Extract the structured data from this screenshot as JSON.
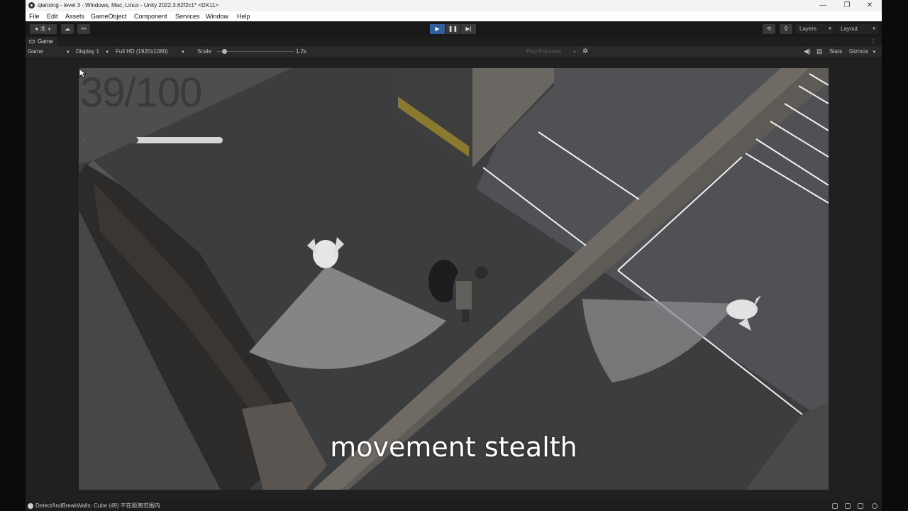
{
  "window": {
    "title": "qianxing - level 3 - Windows, Mac, Linux - Unity 2022.3.62f2c1* <DX11>",
    "minimize": "—",
    "restore": "❐",
    "close": "✕"
  },
  "menu": [
    "File",
    "Edit",
    "Assets",
    "GameObject",
    "Component",
    "Services",
    "Window",
    "Help"
  ],
  "toolbar": {
    "account_label": "北",
    "play": "▶",
    "pause": "❚❚",
    "step": "▶|",
    "layers": "Layers",
    "layout": "Layout",
    "history_icon": "history-icon",
    "search_icon": "search-icon"
  },
  "game_tab": {
    "label": "Game",
    "menu": "⋮"
  },
  "game_controls": {
    "view_mode": "Game",
    "display": "Display 1",
    "resolution": "Full HD (1920x1080)",
    "scale_label": "Scale",
    "scale_value": "1.2x",
    "play_focused": "Play Focused",
    "stats": "Stats",
    "gizmos": "Gizmos"
  },
  "hud": {
    "counter": "39/100",
    "progress": 0.39
  },
  "subtitle": "movement stealth",
  "status": {
    "message": "DetectAndBreakWalls: Cube (49) 不在距离范围内"
  },
  "colors": {
    "accent_play": "#2f5f9c",
    "ground": "#3c3d3f",
    "vision_cone": "#8a8b8d"
  }
}
